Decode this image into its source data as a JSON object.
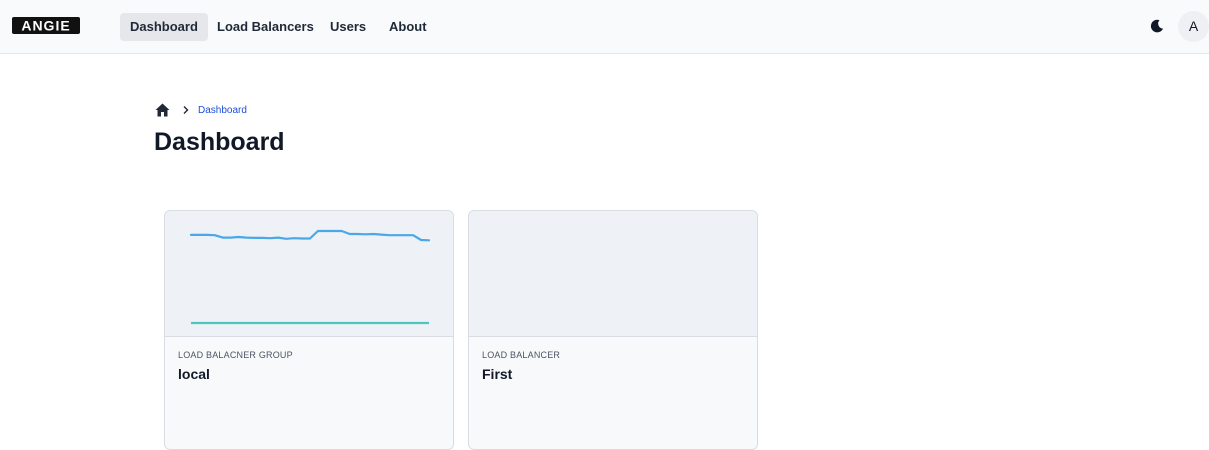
{
  "header": {
    "logo_text": "ANGIE",
    "nav": [
      {
        "label": "Dashboard",
        "active": true
      },
      {
        "label": "Load Balancers",
        "active": false
      },
      {
        "label": "Users",
        "active": false
      },
      {
        "label": "About",
        "active": false
      }
    ],
    "theme_icon": "moon-icon",
    "avatar_initial": "A"
  },
  "breadcrumb": {
    "home_icon": "home-icon",
    "separator_icon": "chevron-right-icon",
    "current": "Dashboard"
  },
  "page": {
    "title": "Dashboard"
  },
  "cards": [
    {
      "label": "LOAD BALACNER GROUP",
      "name": "local",
      "sparkline": {
        "color": "#4aa8e8",
        "values": [
          0.87,
          0.87,
          0.87,
          0.86,
          0.78,
          0.78,
          0.8,
          0.78,
          0.77,
          0.77,
          0.76,
          0.78,
          0.74,
          0.76,
          0.75,
          0.75,
          1.0,
          1.0,
          1.0,
          1.0,
          0.9,
          0.9,
          0.89,
          0.9,
          0.88,
          0.86,
          0.86,
          0.86,
          0.86,
          0.7,
          0.69
        ]
      },
      "baseline": {
        "color": "#4ec6c0"
      }
    },
    {
      "label": "LOAD BALANCER",
      "name": "First"
    }
  ],
  "colors": {
    "accent_link": "#1d4ed8",
    "sparkline": "#4aa8e8",
    "baseline": "#4ec6c0"
  }
}
